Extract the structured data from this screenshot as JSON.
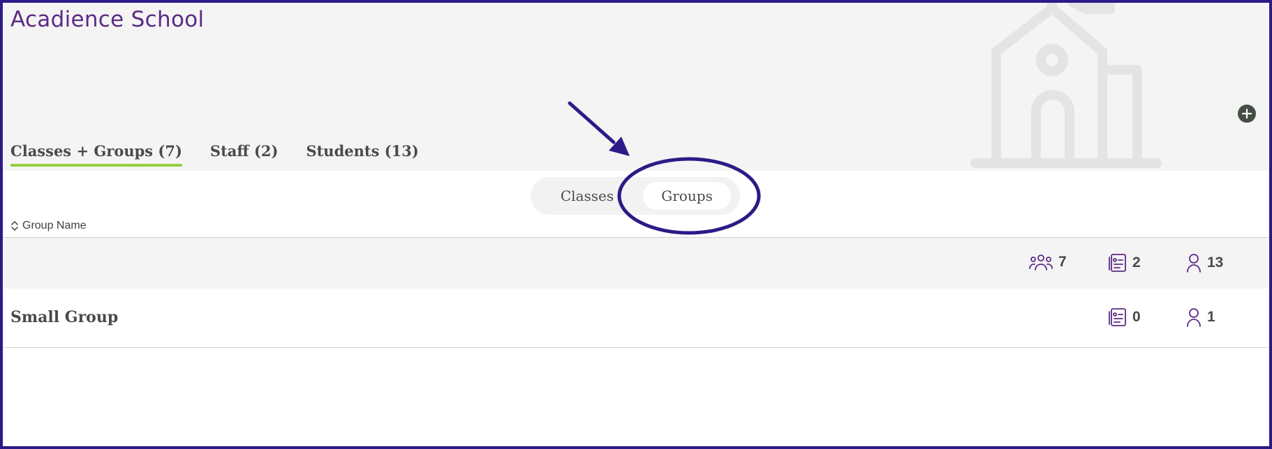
{
  "header": {
    "school_name": "Acadience School",
    "add_icon": "plus-circle-icon",
    "illustration_icon": "school-building-icon"
  },
  "tabs": [
    {
      "label": "Classes + Groups (7)",
      "active": true
    },
    {
      "label": "Staff (2)",
      "active": false
    },
    {
      "label": "Students (13)",
      "active": false
    }
  ],
  "toggle": {
    "options": [
      "Classes",
      "Groups"
    ],
    "selected": "Groups"
  },
  "table": {
    "sort_column_label": "Group Name",
    "sort_icon": "sort-updown-icon"
  },
  "summary": {
    "groups_count": "7",
    "assessments_count": "2",
    "students_count": "13",
    "groups_icon": "people-group-icon",
    "assessments_icon": "clipboard-list-icon",
    "students_icon": "person-icon"
  },
  "rows": [
    {
      "name": "Small Group",
      "assessments": "0",
      "students": "1"
    }
  ],
  "colors": {
    "frame_border": "#2c1b86",
    "brand_purple": "#5b2a86",
    "tab_underline": "#93cf3a",
    "header_bg": "#f4f4f4",
    "annotation": "#2c1b86"
  }
}
